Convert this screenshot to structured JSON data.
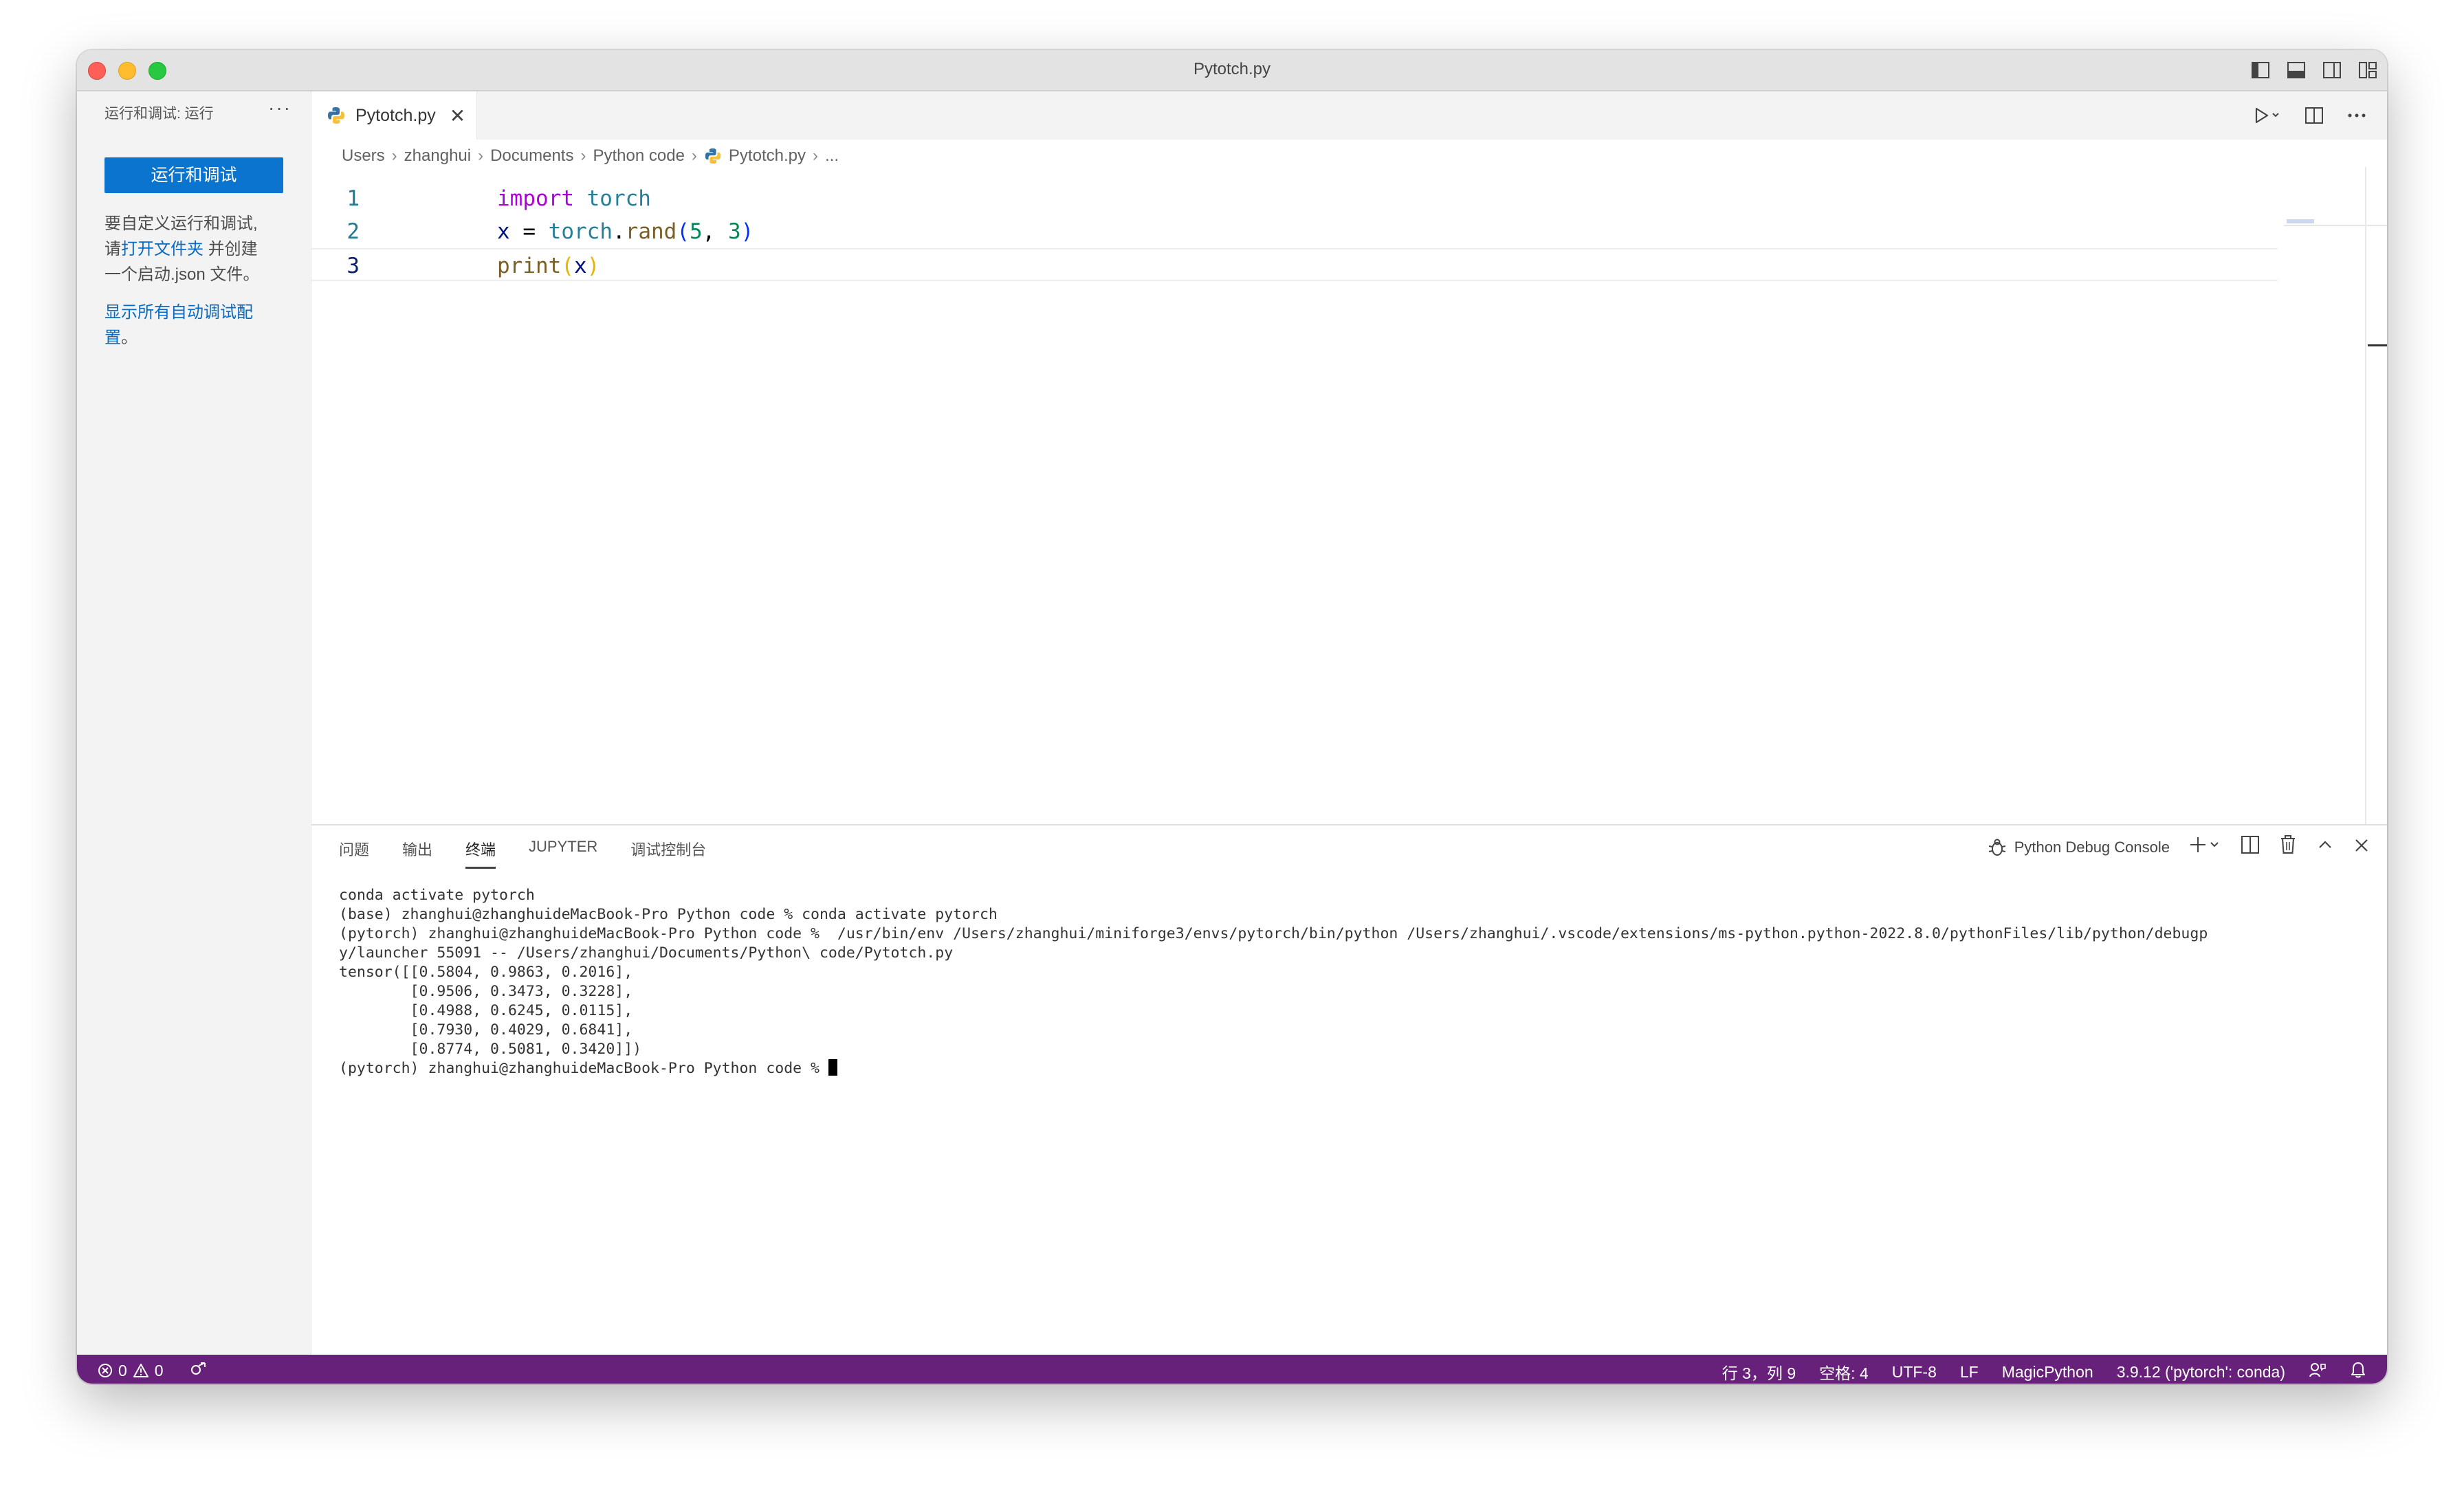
{
  "window": {
    "title": "Pytotch.py"
  },
  "sidebar": {
    "header": "运行和调试: 运行",
    "more": "···",
    "run_button": "运行和调试",
    "desc_line1": "要自定义运行和调试,",
    "desc_line2_prefix": "请",
    "desc_link_open_folder": "打开文件夹",
    "desc_line2_suffix": " 并创建",
    "desc_line3": "一个启动.json 文件。",
    "show_all_link": "显示所有自动调试配置",
    "show_all_suffix": "。"
  },
  "tabs": [
    {
      "label": "Pytotch.py",
      "close": "✕",
      "icon": "python-file-icon"
    }
  ],
  "breadcrumb": [
    "Users",
    "zhanghui",
    "Documents",
    "Python code",
    "Pytotch.py",
    "..."
  ],
  "code": {
    "line_numbers": [
      "1",
      "2",
      "3"
    ],
    "line1": {
      "kw": "import",
      "mod": " torch"
    },
    "line2": {
      "var": "x",
      "eq": " = ",
      "mod": "torch",
      "dot": ".",
      "fn": "rand",
      "open": "(",
      "n1": "5",
      "comma": ", ",
      "n2": "3",
      "close": ")"
    },
    "line3": {
      "fn": "print",
      "open": "(",
      "var": "x",
      "close": ")"
    }
  },
  "panel": {
    "tabs": [
      "问题",
      "输出",
      "终端",
      "JUPYTER",
      "调试控制台"
    ],
    "active_tab": "终端",
    "debug_console": "Python Debug Console",
    "terminal_lines": [
      "conda activate pytorch",
      "(base) zhanghui@zhanghuideMacBook-Pro Python code % conda activate pytorch",
      "(pytorch) zhanghui@zhanghuideMacBook-Pro Python code %  /usr/bin/env /Users/zhanghui/miniforge3/envs/pytorch/bin/python /Users/zhanghui/.vscode/extensions/ms-python.python-2022.8.0/pythonFiles/lib/python/debugp",
      "y/launcher 55091 -- /Users/zhanghui/Documents/Python\\ code/Pytotch.py",
      "tensor([[0.5804, 0.9863, 0.2016],",
      "        [0.9506, 0.3473, 0.3228],",
      "        [0.4988, 0.6245, 0.0115],",
      "        [0.7930, 0.4029, 0.6841],",
      "        [0.8774, 0.5081, 0.3420]])"
    ],
    "prompt": "(pytorch) zhanghui@zhanghuideMacBook-Pro Python code % "
  },
  "statusbar": {
    "errors": "0",
    "warnings": "0",
    "position": "行 3，列 9",
    "spaces": "空格: 4",
    "encoding": "UTF-8",
    "eol": "LF",
    "language": "MagicPython",
    "interpreter": "3.9.12 ('pytorch': conda)"
  },
  "colors": {
    "statusbar": "#68217a",
    "button": "#0a74cf",
    "link": "#0a6bc2"
  }
}
